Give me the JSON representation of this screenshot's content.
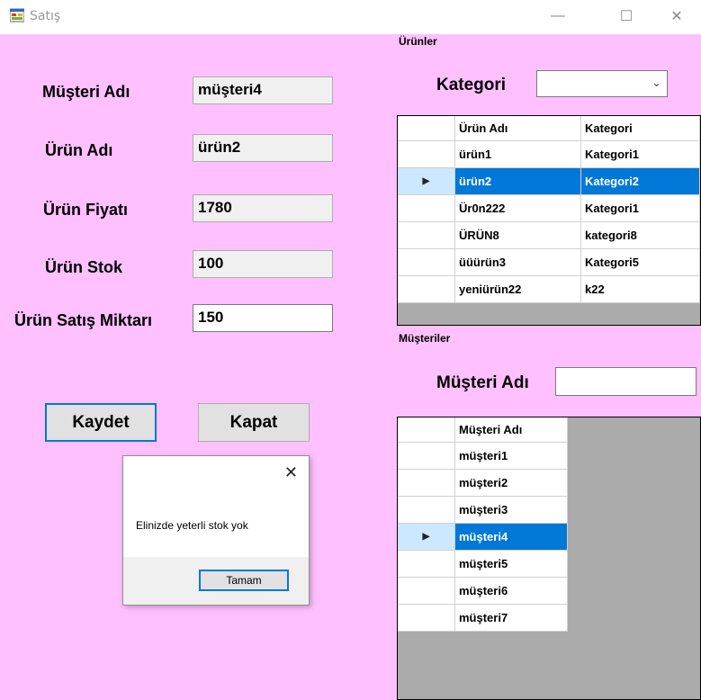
{
  "window": {
    "title": "Satış",
    "controls": {
      "minimize": "—",
      "maximize": "☐",
      "close": "✕"
    }
  },
  "form": {
    "musteri_adi": {
      "label": "Müşteri Adı",
      "value": "müşteri4"
    },
    "urun_adi": {
      "label": "Ürün Adı",
      "value": "ürün2"
    },
    "urun_fiyati": {
      "label": "Ürün Fiyatı",
      "value": "1780"
    },
    "urun_stok": {
      "label": "Ürün Stok",
      "value": "100"
    },
    "satis_miktari": {
      "label": "Ürün Satış Miktarı",
      "value": "150"
    },
    "kaydet_label": "Kaydet",
    "kapat_label": "Kapat"
  },
  "messagebox": {
    "close": "✕",
    "text": "Elinizde yeterli stok yok",
    "ok_label": "Tamam"
  },
  "urunler": {
    "group_title": "Ürünler",
    "kategori_label": "Kategori",
    "kategori_value": "",
    "columns": [
      "Ürün Adı",
      "Kategori"
    ],
    "rows": [
      {
        "ad": "ürün1",
        "kategori": "Kategori1"
      },
      {
        "ad": "ürün2",
        "kategori": "Kategori2"
      },
      {
        "ad": "Ür0n222",
        "kategori": "Kategori1"
      },
      {
        "ad": "ÜRÜN8",
        "kategori": "kategori8"
      },
      {
        "ad": "üüürün3",
        "kategori": "Kategori5"
      },
      {
        "ad": "yeniürün22",
        "kategori": "k22"
      }
    ],
    "selected_row": 1
  },
  "musteriler": {
    "group_title": "Müşteriler",
    "search_label": "Müşteri Adı",
    "search_value": "",
    "columns": [
      "Müşteri Adı"
    ],
    "rows": [
      "müşteri1",
      "müşteri2",
      "müşteri3",
      "müşteri4",
      "müşteri5",
      "müşteri6",
      "müşteri7"
    ],
    "selected_row": 3
  },
  "colors": {
    "form_background": "#ffc0ff",
    "selection": "#0078d7",
    "grid_background": "#ababab"
  }
}
